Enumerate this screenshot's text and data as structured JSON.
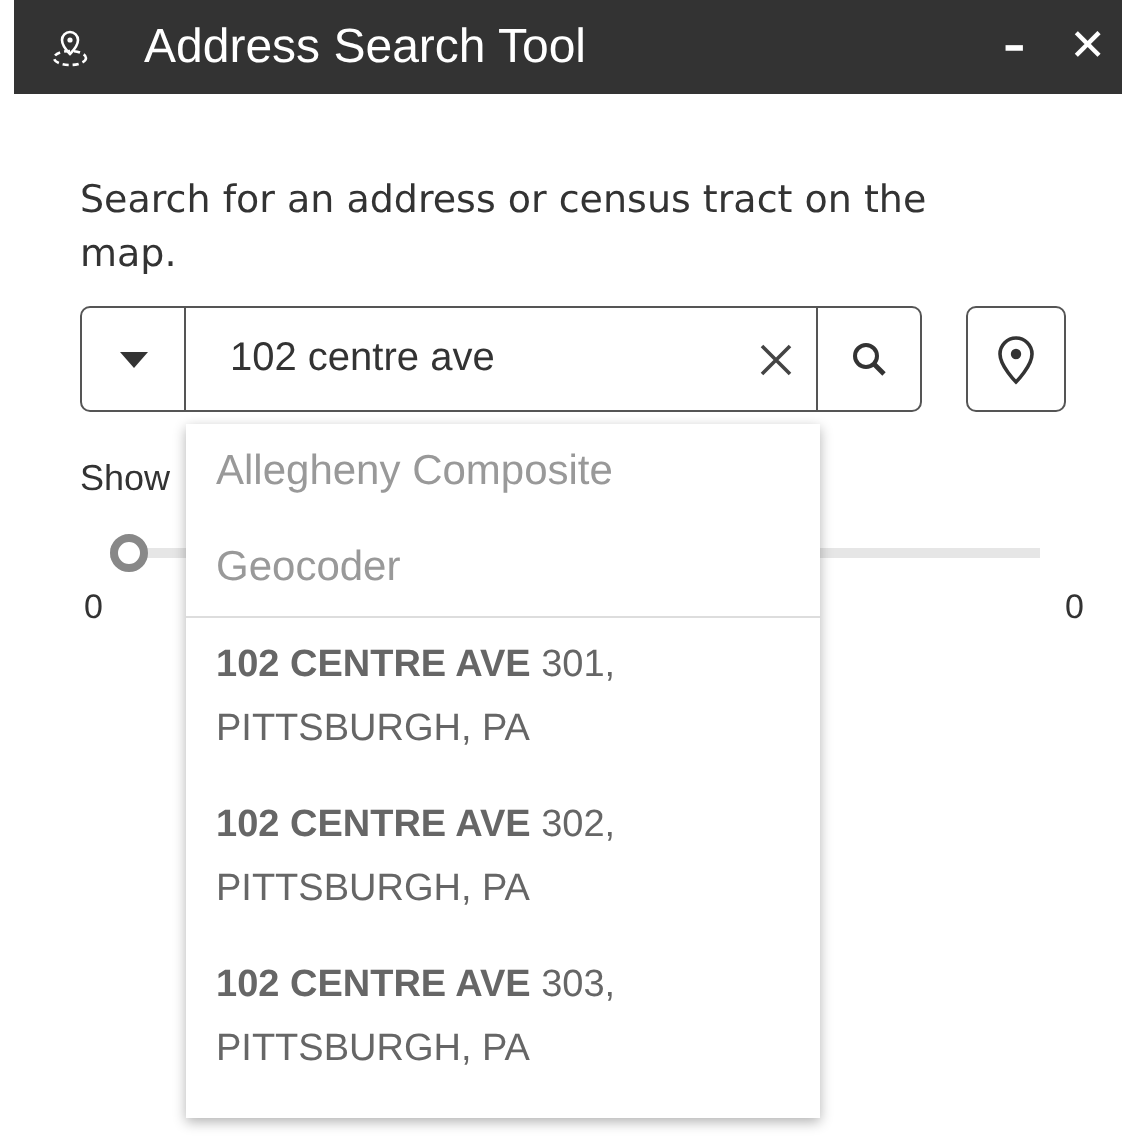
{
  "window": {
    "title": "Address Search Tool",
    "minimize": "–",
    "close": "✕"
  },
  "description": "Search for an address or census tract on the map.",
  "search": {
    "value": "102 centre ave"
  },
  "slider": {
    "label": "Show",
    "level": 0,
    "min_label": "0",
    "max_label": "0"
  },
  "suggestions": {
    "source": "Allegheny Composite Geocoder",
    "items": [
      {
        "text": "**102 CENTRE AVE** 301, PITTSBURGH, PA"
      },
      {
        "text": "**102 CENTRE AVE** 302, PITTSBURGH, PA"
      },
      {
        "text": "**102 CENTRE AVE** 303, PITTSBURGH, PA"
      }
    ]
  }
}
